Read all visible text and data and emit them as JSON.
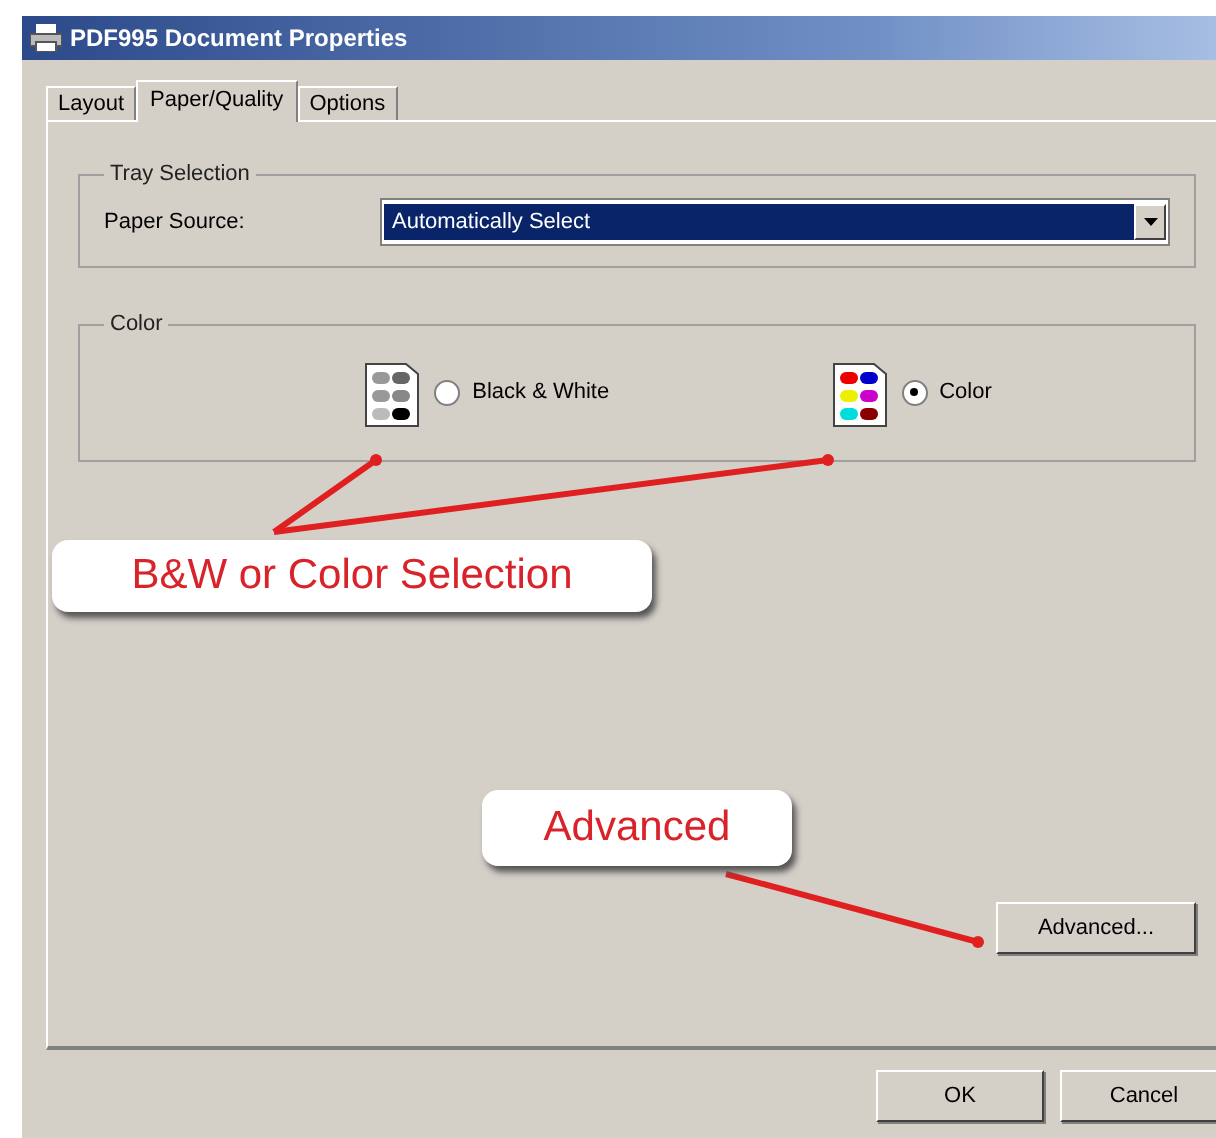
{
  "window": {
    "title": "PDF995 Document Properties"
  },
  "tabs": [
    {
      "label": "Layout",
      "selected": false
    },
    {
      "label": "Paper/Quality",
      "selected": true
    },
    {
      "label": "Options",
      "selected": false
    }
  ],
  "tray_selection": {
    "label": "Tray Selection",
    "paper_source_label": "Paper Source:",
    "paper_source_value": "Automatically Select"
  },
  "color_group": {
    "label": "Color",
    "options": [
      {
        "kind": "mono",
        "label": "Black & White",
        "selected": false
      },
      {
        "kind": "color",
        "label": "Color",
        "selected": true
      }
    ]
  },
  "advanced_button": "Advanced...",
  "buttons": [
    "OK",
    "Cancel"
  ],
  "annotations": [
    {
      "text": "B&W or Color Selection"
    },
    {
      "text": "Advanced"
    }
  ]
}
